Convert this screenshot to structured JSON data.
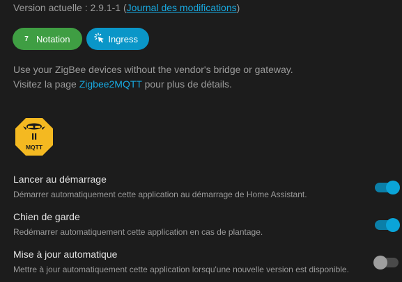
{
  "version": {
    "prefix": "Version actuelle : 2.9.1-1 (",
    "changelog_link": "Journal des modifications",
    "suffix": ")"
  },
  "chips": {
    "rating": {
      "badge": "7",
      "label": "Notation"
    },
    "ingress": {
      "label": "Ingress"
    }
  },
  "description": {
    "line1": "Use your ZigBee devices without the vendor's bridge or gateway.",
    "line2_prefix": "Visitez la page ",
    "line2_link": "Zigbee2MQTT",
    "line2_suffix": " pour plus de détails."
  },
  "logo": {
    "text": "MQTT",
    "icon": "zigbee2mqtt-bee-logo"
  },
  "options": [
    {
      "title": "Lancer au démarrage",
      "subtitle": "Démarrer automatiquement cette application au démarrage de Home Assistant.",
      "enabled": true
    },
    {
      "title": "Chien de garde",
      "subtitle": "Redémarrer automatiquement cette application en cas de plantage.",
      "enabled": true
    },
    {
      "title": "Mise à jour automatique",
      "subtitle": "Mettre à jour automatiquement cette application lorsqu'une nouvelle version est disponible.",
      "enabled": false
    }
  ],
  "colors": {
    "background": "#1c1c1c",
    "accent": "#18a9e0",
    "rating_chip": "#3f9e43",
    "ingress_chip": "#0a96c8",
    "logo_yellow": "#f4b921"
  }
}
